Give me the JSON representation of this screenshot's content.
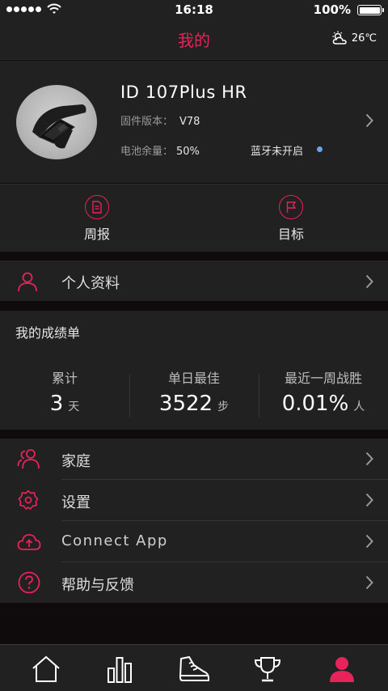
{
  "status_bar": {
    "time": "16:18",
    "battery_text": "100%"
  },
  "header": {
    "title": "我的",
    "weather": {
      "temperature": "26℃",
      "icon": "partly-cloudy-icon"
    }
  },
  "device": {
    "name": "ID 107Plus HR",
    "firmware_label": "固件版本：",
    "firmware_value": "V78",
    "battery_label": "电池余量：",
    "battery_value": "50%",
    "bluetooth_status": "蓝牙未开启"
  },
  "shortcuts": [
    {
      "label": "周报",
      "icon": "report-icon"
    },
    {
      "label": "目标",
      "icon": "flag-icon"
    }
  ],
  "profile_row": {
    "label": "个人资料",
    "icon": "person-icon"
  },
  "scoreboard": {
    "title": "我的成绩单",
    "stats": [
      {
        "title": "累计",
        "value": "3",
        "unit": "天"
      },
      {
        "title": "单日最佳",
        "value": "3522",
        "unit": "步"
      },
      {
        "title": "最近一周战胜",
        "value": "0.01%",
        "unit": "人"
      }
    ]
  },
  "menu": [
    {
      "label": "家庭",
      "icon": "family-icon"
    },
    {
      "label": "设置",
      "icon": "settings-gear-icon"
    },
    {
      "label": "Connect  App",
      "icon": "cloud-upload-icon"
    },
    {
      "label": "帮助与反馈",
      "icon": "help-icon"
    }
  ],
  "tabs": [
    {
      "name": "home",
      "icon": "home-icon"
    },
    {
      "name": "stats",
      "icon": "bar-chart-icon"
    },
    {
      "name": "sport",
      "icon": "shoe-icon"
    },
    {
      "name": "ranking",
      "icon": "trophy-icon"
    },
    {
      "name": "me",
      "icon": "user-icon",
      "active": true
    }
  ],
  "colors": {
    "accent": "#e8225a",
    "panel": "#212121",
    "background": "#0f0b0c",
    "bluetooth_dot": "#6aa3e8"
  }
}
